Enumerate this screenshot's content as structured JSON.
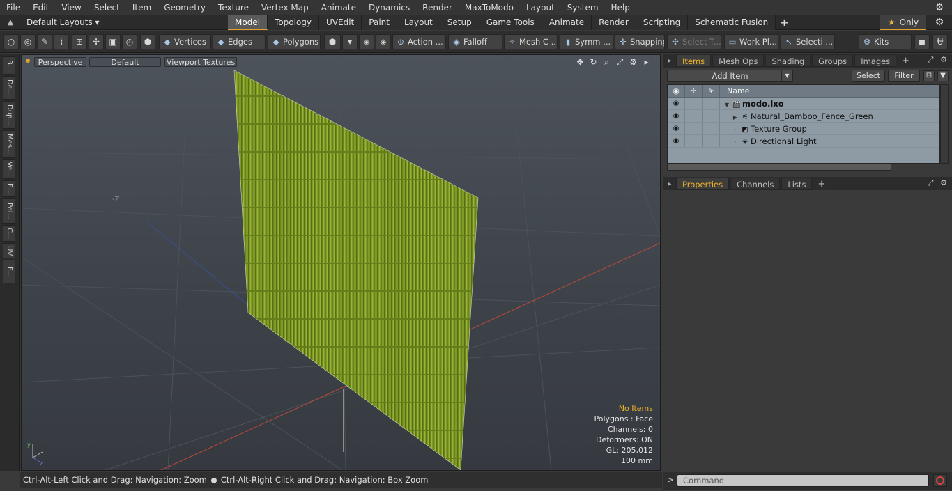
{
  "menu": [
    "File",
    "Edit",
    "View",
    "Select",
    "Item",
    "Geometry",
    "Texture",
    "Vertex Map",
    "Animate",
    "Dynamics",
    "Render",
    "MaxToModo",
    "Layout",
    "System",
    "Help"
  ],
  "layouts": {
    "selector": "Default Layouts ▾"
  },
  "tabs": [
    "Model",
    "Topology",
    "UVEdit",
    "Paint",
    "Layout",
    "Setup",
    "Game Tools",
    "Animate",
    "Render",
    "Scripting",
    "Schematic Fusion"
  ],
  "active_tab": "Model",
  "only_label": "Only",
  "toolbar": {
    "vertices": "Vertices",
    "edges": "Edges",
    "polygons": "Polygons",
    "action": "Action ...",
    "falloff": "Falloff",
    "mesh": "Mesh C ...",
    "symm": "Symm ...",
    "snapping": "Snapping",
    "select_t": "Select T...",
    "work_pl": "Work Pl...",
    "selecti": "Selecti ...",
    "kits": "Kits"
  },
  "left_tools": [
    "B...",
    "De...",
    "Dup...",
    "Mes...",
    "Ve...",
    "E...",
    "Pol...",
    "C...",
    "UV",
    "F..."
  ],
  "viewport": {
    "view": "Perspective",
    "shading": "Default",
    "textures": "Viewport Textures",
    "axis_label": "-Z",
    "info": {
      "no_items": "No Items",
      "polygons": "Polygons : Face",
      "channels": "Channels: 0",
      "deformers": "Deformers: ON",
      "gl": "GL: 205,012",
      "scale": "100 mm"
    }
  },
  "status": {
    "left": "Ctrl-Alt-Left Click and Drag: Navigation: Zoom",
    "right": "Ctrl-Alt-Right Click and Drag: Navigation: Box Zoom"
  },
  "items_panel": {
    "tabs": [
      "Items",
      "Mesh Ops",
      "Shading",
      "Groups",
      "Images"
    ],
    "active": "Items",
    "add_item": "Add Item",
    "select": "Select",
    "filter": "Filter",
    "name_col": "Name",
    "rows": [
      {
        "label": "modo.lxo"
      },
      {
        "label": "Natural_Bamboo_Fence_Green"
      },
      {
        "label": "Texture Group"
      },
      {
        "label": "Directional Light"
      }
    ]
  },
  "props_panel": {
    "tabs": [
      "Properties",
      "Channels",
      "Lists"
    ],
    "active": "Properties"
  },
  "command": {
    "placeholder": "Command"
  },
  "colors": {
    "accent": "#e0a22a",
    "bamboo": "#8fae2a",
    "viewport": "#454a51"
  }
}
